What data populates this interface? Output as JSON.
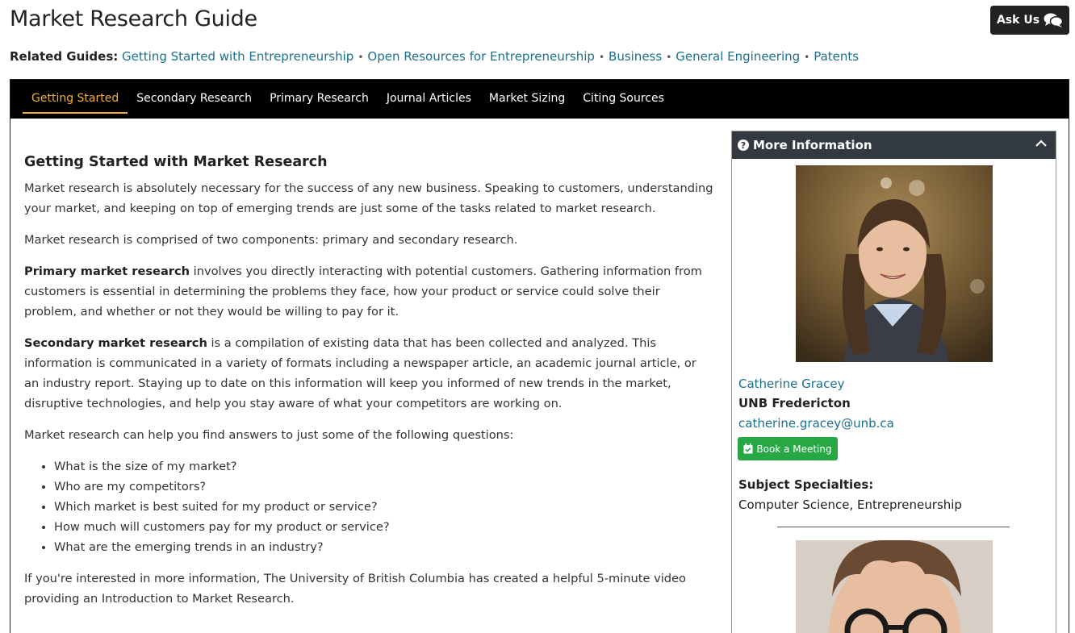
{
  "page": {
    "title": "Market Research Guide"
  },
  "ask_us": {
    "label": "Ask Us"
  },
  "related": {
    "label": "Related Guides:",
    "links": [
      "Getting Started with Entrepreneurship",
      "Open Resources for Entrepreneurship",
      "Business",
      "General Engineering",
      "Patents"
    ],
    "separator": "•"
  },
  "tabs": [
    {
      "label": "Getting Started",
      "active": true
    },
    {
      "label": "Secondary Research",
      "active": false
    },
    {
      "label": "Primary Research",
      "active": false
    },
    {
      "label": "Journal Articles",
      "active": false
    },
    {
      "label": "Market Sizing",
      "active": false
    },
    {
      "label": "Citing Sources",
      "active": false
    }
  ],
  "main": {
    "heading": "Getting Started with Market Research",
    "p1": "Market research is absolutely necessary for the success of any new business. Speaking to customers, understanding your market, and keeping on top of emerging trends are just some of the tasks related to market research.",
    "p2": "Market research is comprised of two components: primary and secondary research.",
    "p3_bold": "Primary market research",
    "p3_rest": " involves you directly interacting with potential customers. Gathering information from customers is essential in determining the problems they face, how your product or service could solve their problem, and whether or not they would be willing to pay for it.",
    "p4_bold": "Secondary market research",
    "p4_rest": " is a compilation of existing data that has been collected and analyzed. This information is communicated in a variety of formats including a newspaper article, an academic journal article, or an industry report. Staying up to date on this information will keep you informed of new trends in the market, disruptive technologies, and help you stay aware of what your competitors are working on.",
    "p5": "Market research can help you find answers to just some of the following questions:",
    "questions": [
      "What is the size of my market?",
      "Who are my competitors?",
      "Which market is best suited for my product or service?",
      "How much will customers pay for my product or service?",
      "What are the emerging trends in an industry?"
    ],
    "p6": "If you're interested in more information, The University of British Columbia has created a helpful 5-minute video providing an Introduction to Market Research."
  },
  "sidebar": {
    "title": "More Information",
    "profile": {
      "name": "Catherine Gracey",
      "org": "UNB Fredericton",
      "email": "catherine.gracey@unb.ca",
      "book_label": "Book a Meeting",
      "spec_label": "Subject Specialties:",
      "spec_value": "Computer Science, Entrepreneurship"
    }
  },
  "colors": {
    "link": "#1a6f8c",
    "active_tab": "#f2b134",
    "book_button": "#28a745",
    "panel_header": "#333940"
  }
}
